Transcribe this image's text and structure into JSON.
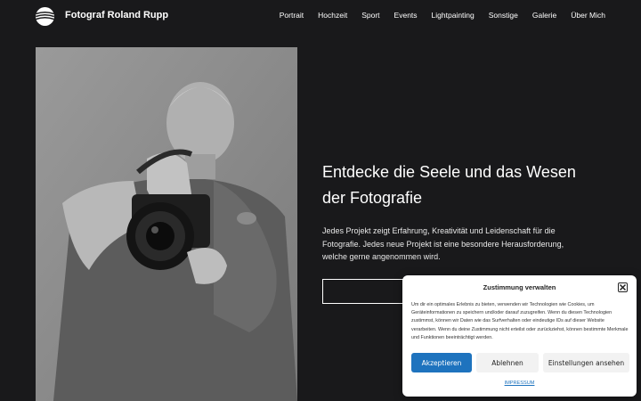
{
  "header": {
    "site_title": "Fotograf Roland Rupp",
    "logo_icon": "logo-icon",
    "nav": [
      {
        "label": "Portrait"
      },
      {
        "label": "Hochzeit"
      },
      {
        "label": "Sport"
      },
      {
        "label": "Events"
      },
      {
        "label": "Lightpainting"
      },
      {
        "label": "Sonstige"
      },
      {
        "label": "Galerie"
      },
      {
        "label": "Über Mich"
      }
    ]
  },
  "hero": {
    "title": "Entdecke die Seele und das Wesen der Fotografie",
    "text": "Jedes Projekt zeigt Erfahrung, Kreativität und Leidenschaft für die Fotografie. Jedes neue Projekt ist eine besondere Herausforderung, welche gerne angenommen wird.",
    "button_label": ""
  },
  "consent": {
    "title": "Zustimmung verwalten",
    "text": "Um dir ein optimales Erlebnis zu bieten, verwenden wir Technologien wie Cookies, um Geräteinformationen zu speichern und/oder darauf zuzugreifen. Wenn du diesen Technologien zustimmst, können wir Daten wie das Surfverhalten oder eindeutige IDs auf dieser Website verarbeiten. Wenn du deine Zustimmung nicht erteilst oder zurückziehst, können bestimmte Merkmale und Funktionen beeinträchtigt werden.",
    "accept_label": "Akzeptieren",
    "deny_label": "Ablehnen",
    "preferences_label": "Einstellungen ansehen",
    "impressum_label": "IMPRESSUM",
    "close_icon": "close-icon"
  },
  "colors": {
    "background": "#19191b",
    "accent": "#1e73be"
  }
}
